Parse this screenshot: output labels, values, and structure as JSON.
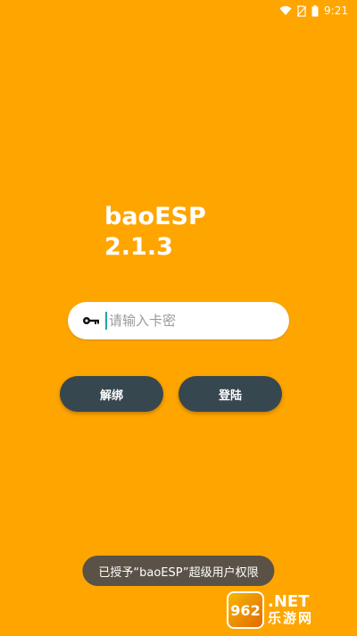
{
  "status_bar": {
    "time": "9:21",
    "icons": [
      "wifi-icon",
      "no-sim-icon",
      "battery-icon"
    ]
  },
  "app": {
    "name": "baoESP",
    "version": "2.1.3"
  },
  "login": {
    "key_placeholder": "请输入卡密",
    "key_value": "",
    "unbind_label": "解绑",
    "login_label": "登陆"
  },
  "toast": {
    "message": "已授予“baoESP”超级用户权限"
  },
  "watermark": {
    "logo_text": "962",
    "line1": ".NET",
    "line2": "乐游网"
  },
  "colors": {
    "background": "#FFA500",
    "button": "#37474F",
    "input_bg": "#FFFFFF",
    "toast_bg": "#5A5247",
    "cursor": "#1EA7A0"
  }
}
